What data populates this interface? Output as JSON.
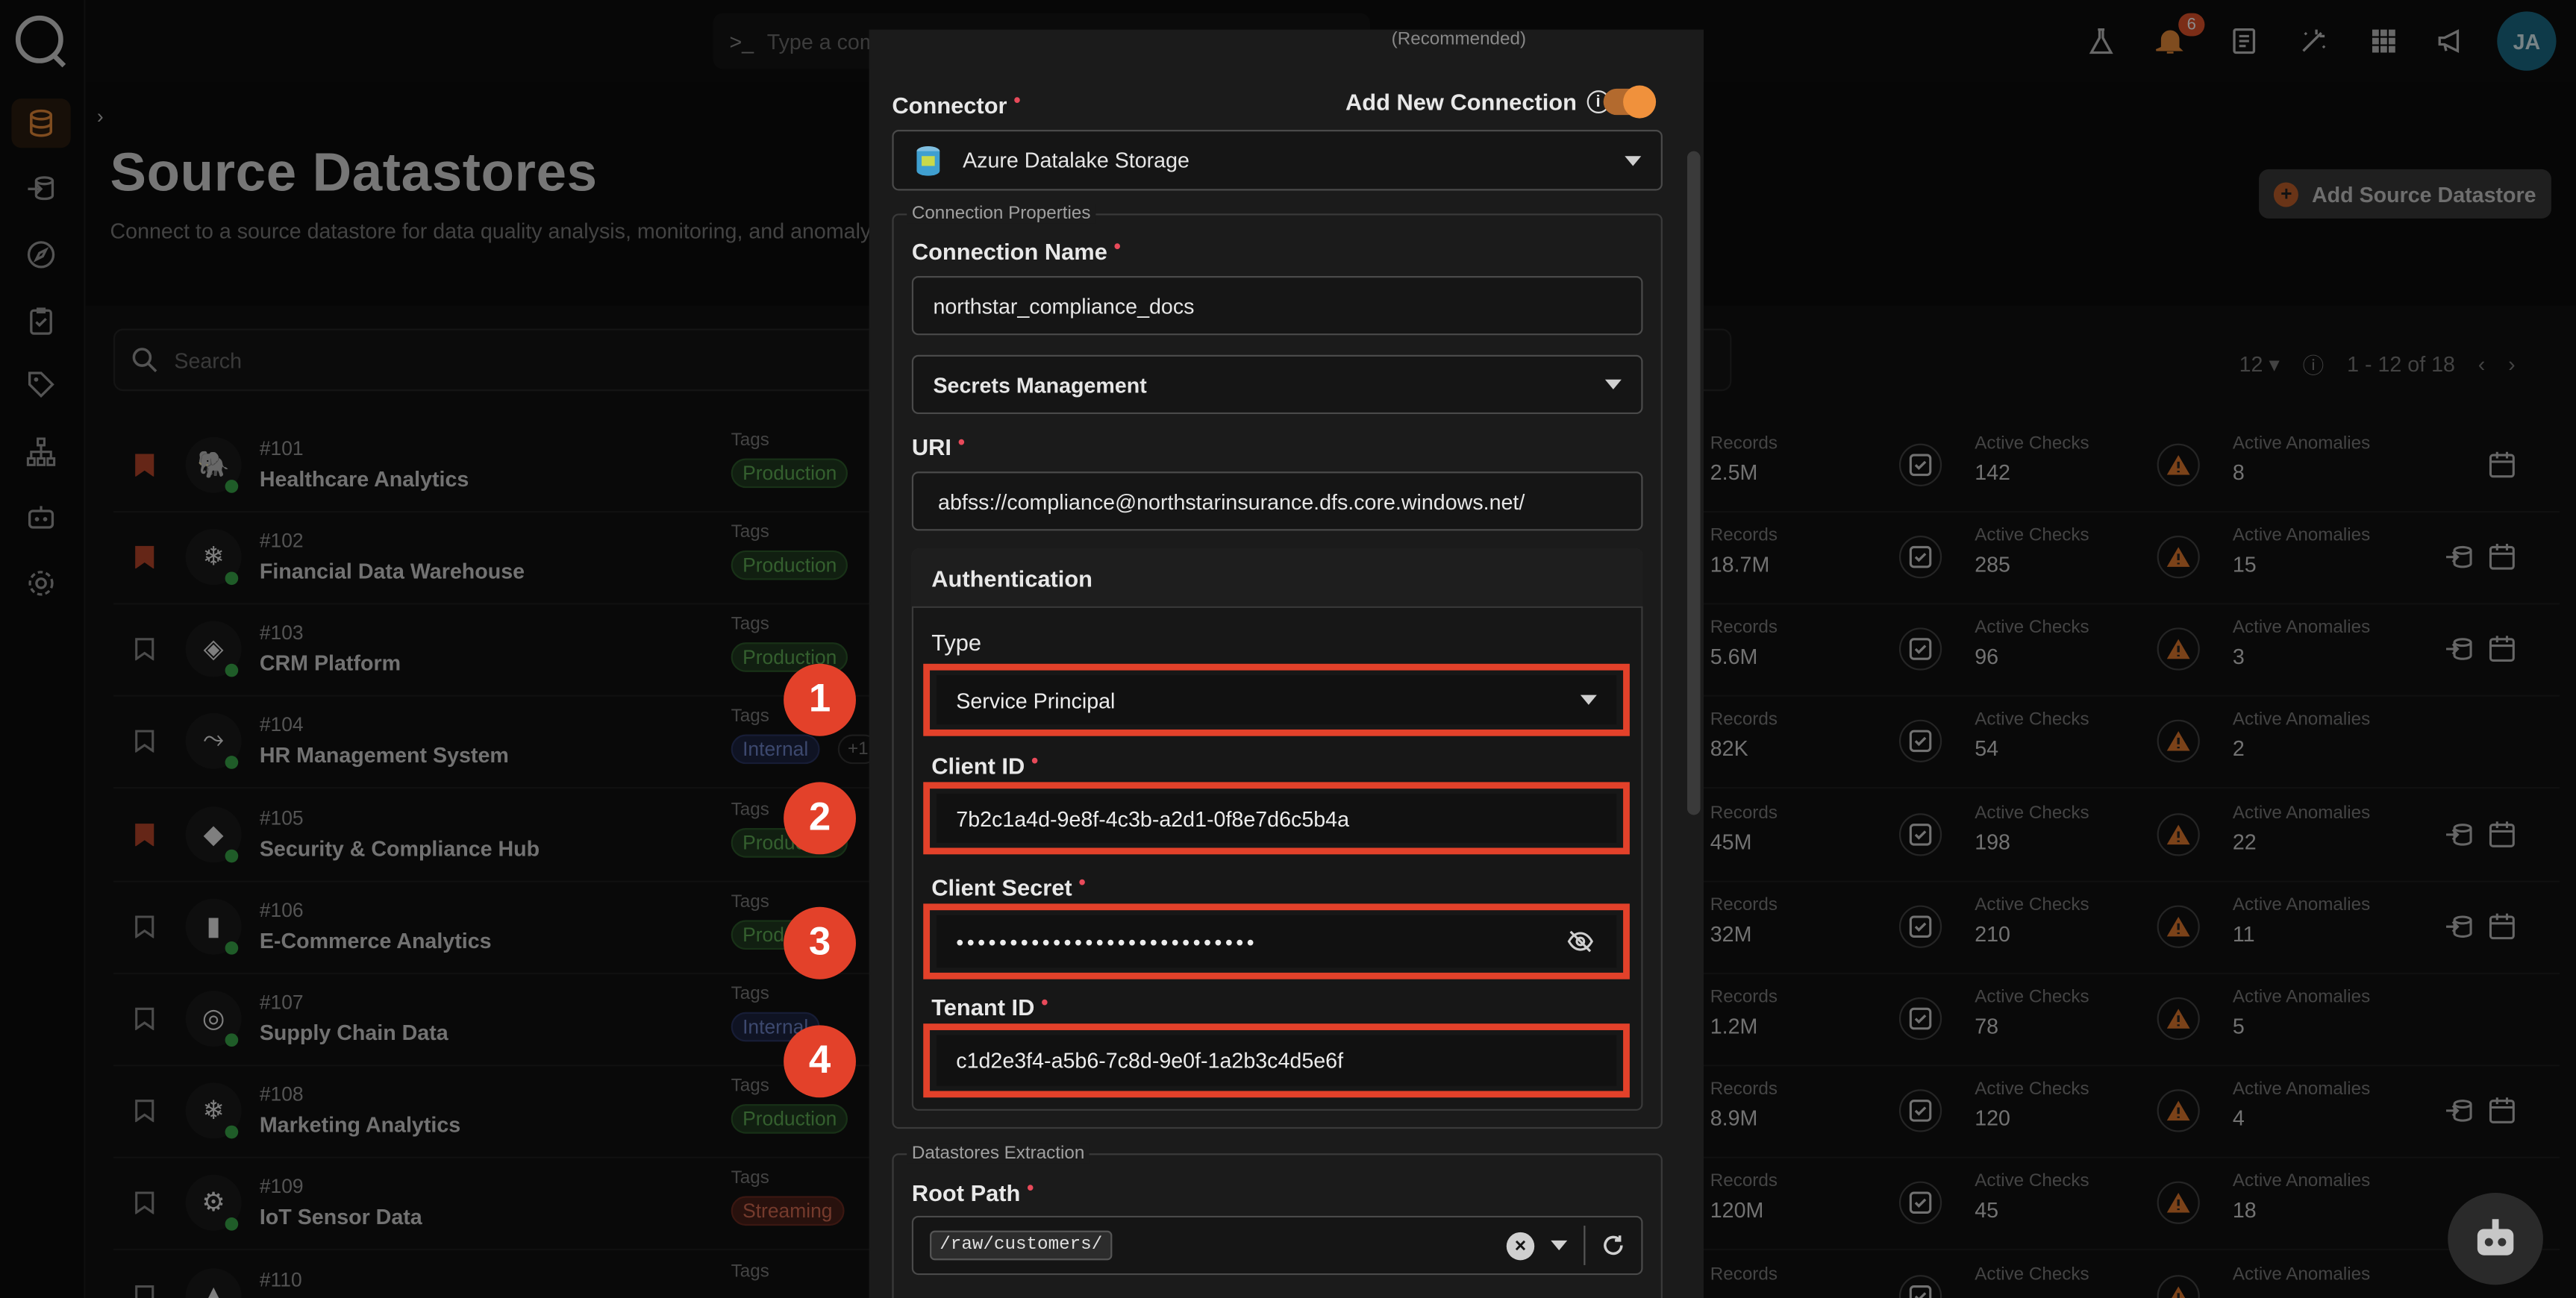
{
  "top": {
    "command_placeholder": "Type a command...",
    "notification_count": "6",
    "avatar_initials": "JA"
  },
  "page": {
    "title": "Source Datastores",
    "subtitle": "Connect to a source datastore for data quality analysis, monitoring, and anomaly detection.",
    "add_button": "Add Source Datastore",
    "search_placeholder": "Search",
    "page_size": "12",
    "range": "1 - 12 of 18"
  },
  "row_labels": {
    "tags": "Tags",
    "records": "Records",
    "checks": "Active Checks",
    "anomalies": "Active Anomalies"
  },
  "datastores": [
    {
      "id": "#101",
      "name": "Healthcare Analytics",
      "tag": "Production",
      "tag_kind": "production",
      "extra": "",
      "records": "2.5M",
      "checks": "142",
      "anomalies": "8",
      "bookmarked": true,
      "icon": "🐘",
      "acts": 1
    },
    {
      "id": "#102",
      "name": "Financial Data Warehouse",
      "tag": "Production",
      "tag_kind": "production",
      "extra": "",
      "records": "18.7M",
      "checks": "285",
      "anomalies": "15",
      "bookmarked": true,
      "icon": "❄",
      "acts": 2
    },
    {
      "id": "#103",
      "name": "CRM Platform",
      "tag": "Production",
      "tag_kind": "production",
      "extra": "",
      "records": "5.6M",
      "checks": "96",
      "anomalies": "3",
      "bookmarked": false,
      "icon": "◈",
      "acts": 2
    },
    {
      "id": "#104",
      "name": "HR Management System",
      "tag": "Internal",
      "tag_kind": "internal",
      "extra": "+1",
      "records": "82K",
      "checks": "54",
      "anomalies": "2",
      "bookmarked": false,
      "icon": "⤳",
      "acts": 0
    },
    {
      "id": "#105",
      "name": "Security & Compliance Hub",
      "tag": "Production",
      "tag_kind": "production",
      "extra": "",
      "records": "45M",
      "checks": "198",
      "anomalies": "22",
      "bookmarked": true,
      "icon": "◆",
      "acts": 2
    },
    {
      "id": "#106",
      "name": "E-Commerce Analytics",
      "tag": "Production",
      "tag_kind": "production",
      "extra": "",
      "records": "32M",
      "checks": "210",
      "anomalies": "11",
      "bookmarked": false,
      "icon": "▮",
      "acts": 2
    },
    {
      "id": "#107",
      "name": "Supply Chain Data",
      "tag": "Internal",
      "tag_kind": "internal",
      "extra": "",
      "records": "1.2M",
      "checks": "78",
      "anomalies": "5",
      "bookmarked": false,
      "icon": "◎",
      "acts": 0
    },
    {
      "id": "#108",
      "name": "Marketing Analytics",
      "tag": "Production",
      "tag_kind": "production",
      "extra": "",
      "records": "8.9M",
      "checks": "120",
      "anomalies": "4",
      "bookmarked": false,
      "icon": "❄",
      "acts": 2
    },
    {
      "id": "#109",
      "name": "IoT Sensor Data",
      "tag": "Streaming",
      "tag_kind": "streaming",
      "extra": "",
      "records": "120M",
      "checks": "45",
      "anomalies": "18",
      "bookmarked": false,
      "icon": "⚙",
      "acts": 0
    },
    {
      "id": "#110",
      "name": "",
      "tag": "",
      "tag_kind": "production",
      "extra": "",
      "records": "",
      "checks": "",
      "anomalies": "",
      "bookmarked": false,
      "icon": "▲",
      "acts": 0
    }
  ],
  "modal": {
    "top_hint": "(Recommended)",
    "connector_label": "Connector",
    "add_new_connection_label": "Add New Connection",
    "connector_value": "Azure Datalake Storage",
    "connection_properties_legend": "Connection Properties",
    "connection_name_label": "Connection Name",
    "connection_name_value": "northstar_compliance_docs",
    "secrets_label": "Secrets Management",
    "uri_label": "URI",
    "uri_value": "abfss://compliance@northstarinsurance.dfs.core.windows.net/",
    "auth_header": "Authentication",
    "type_label": "Type",
    "type_value": "Service Principal",
    "client_id_label": "Client ID",
    "client_id_value": "7b2c1a4d-9e8f-4c3b-a2d1-0f8e7d6c5b4a",
    "client_secret_label": "Client Secret",
    "client_secret_value": "••••••••••••••••••••••••••••",
    "tenant_id_label": "Tenant ID",
    "tenant_id_value": "c1d2e3f4-a5b6-7c8d-9e0f-1a2b3c4d5e6f",
    "extraction_legend": "Datastores Extraction",
    "root_path_label": "Root Path",
    "root_path_value": "/raw/customers/",
    "callouts": [
      "1",
      "2",
      "3",
      "4"
    ]
  },
  "colors": {
    "accent": "#f0913c",
    "highlight": "#e3412a",
    "required": "#e84a5a"
  }
}
